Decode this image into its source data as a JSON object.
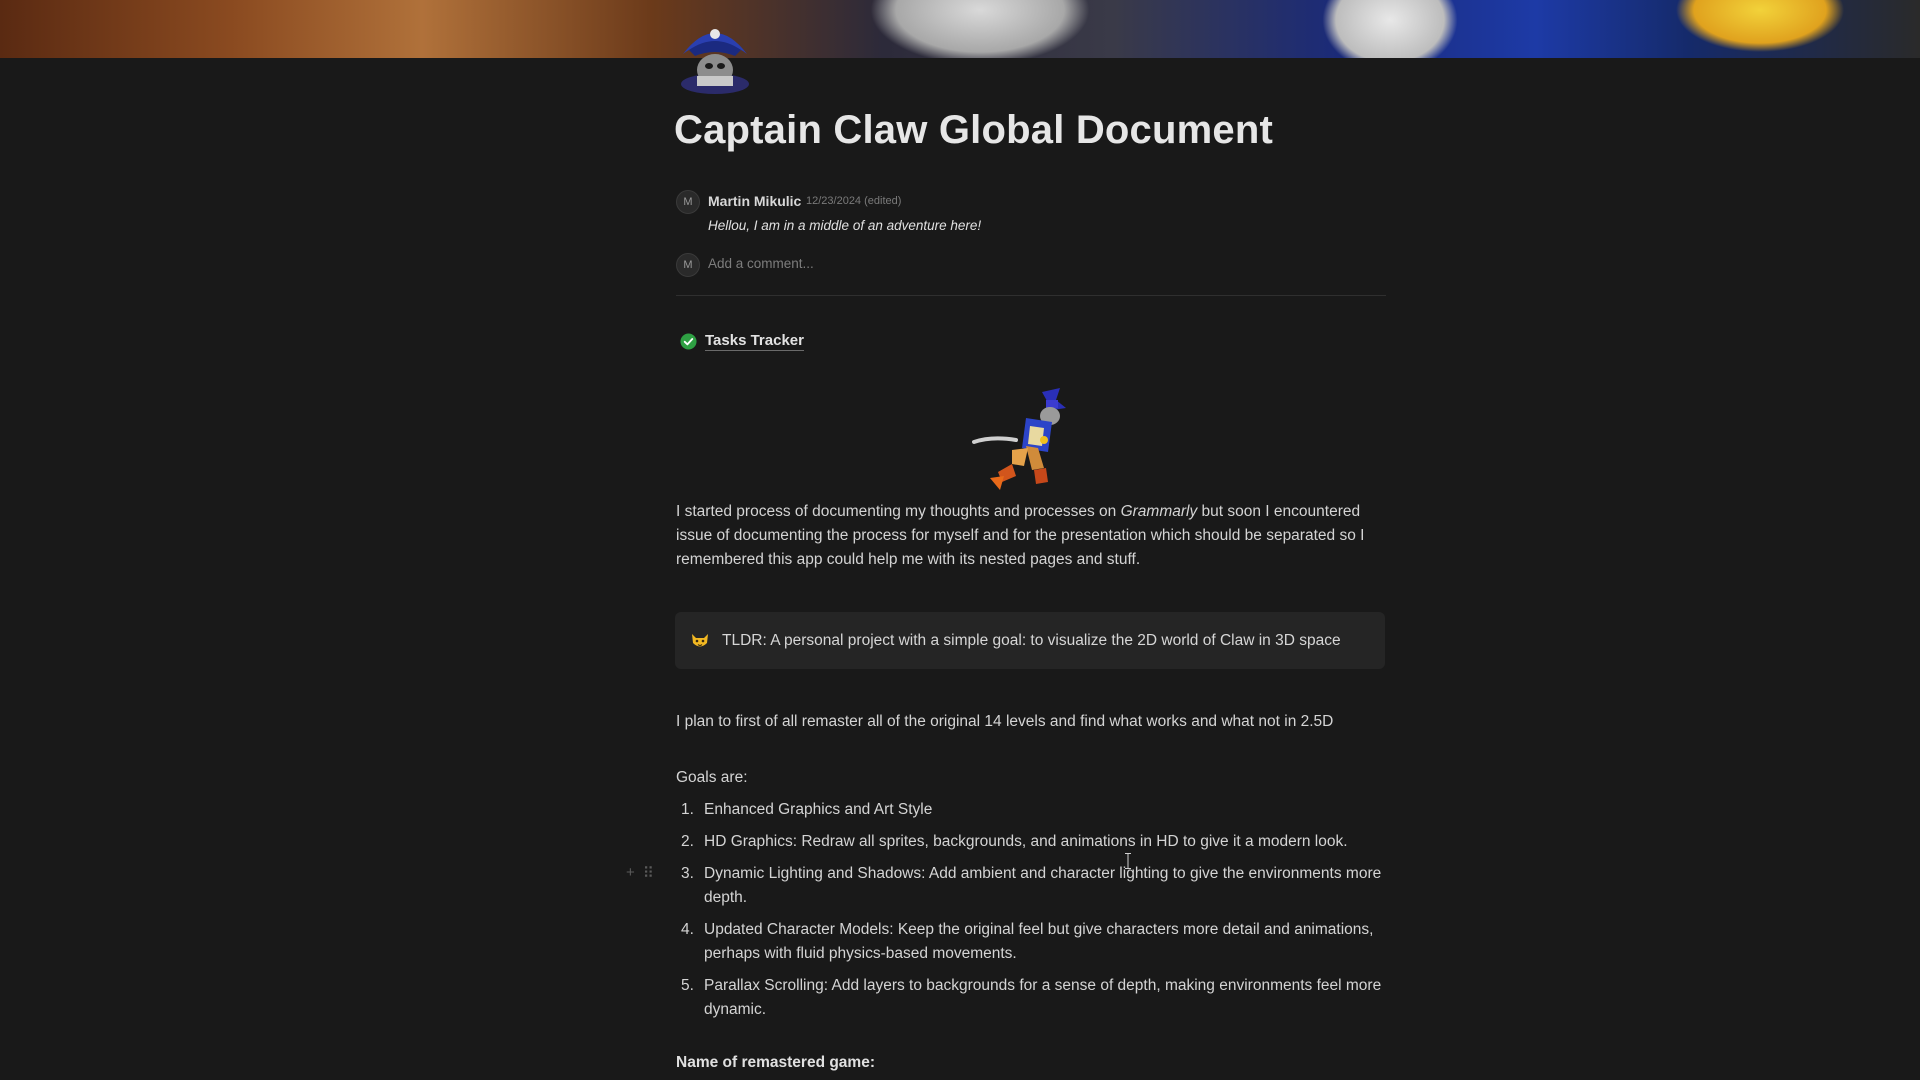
{
  "page": {
    "title": "Captain Claw Global Document"
  },
  "comment": {
    "avatar_initial": "M",
    "author": "Martin Mikulic",
    "date": "12/23/2024 (edited)",
    "body": "Hellou, I am in a middle of an adventure here!"
  },
  "add_comment": {
    "avatar_initial": "M",
    "placeholder": "Add a comment..."
  },
  "tasks_link": {
    "label": "Tasks Tracker",
    "icon": "check-circle-icon",
    "color": "#2ea043"
  },
  "intro": {
    "before": "I started process of documenting my thoughts and processes on ",
    "emphasis": "Grammarly",
    "after": " but soon I encountered issue of documenting the process for myself and for the presentation which should be separated so I remembered this app could help me with its nested pages and stuff."
  },
  "callout": {
    "icon": "cat-face-icon",
    "text": "TLDR: A personal project with a simple goal: to visualize the 2D world of Claw in 3D space"
  },
  "plan_text": "I plan to first of all remaster all of the original 14 levels and find what works and what not in 2.5D",
  "goals": {
    "heading": "Goals are:",
    "items": [
      {
        "num": "1.",
        "text": "Enhanced Graphics and Art Style"
      },
      {
        "num": "2.",
        "text": "HD Graphics: Redraw all sprites, backgrounds, and animations in HD to give it a modern look."
      },
      {
        "num": "3.",
        "text": "Dynamic Lighting and Shadows: Add ambient and character lighting to give the environments more depth."
      },
      {
        "num": "4.",
        "text": "Updated Character Models: Keep the original feel but give characters more detail and animations, perhaps with fluid physics-based movements."
      },
      {
        "num": "5.",
        "text": "Parallax Scrolling: Add layers to backgrounds for a sense of depth, making environments feel more dynamic."
      }
    ]
  },
  "remastered_heading": "Name of remastered game:",
  "block_controls": {
    "add": "+",
    "drag": "⠿"
  }
}
